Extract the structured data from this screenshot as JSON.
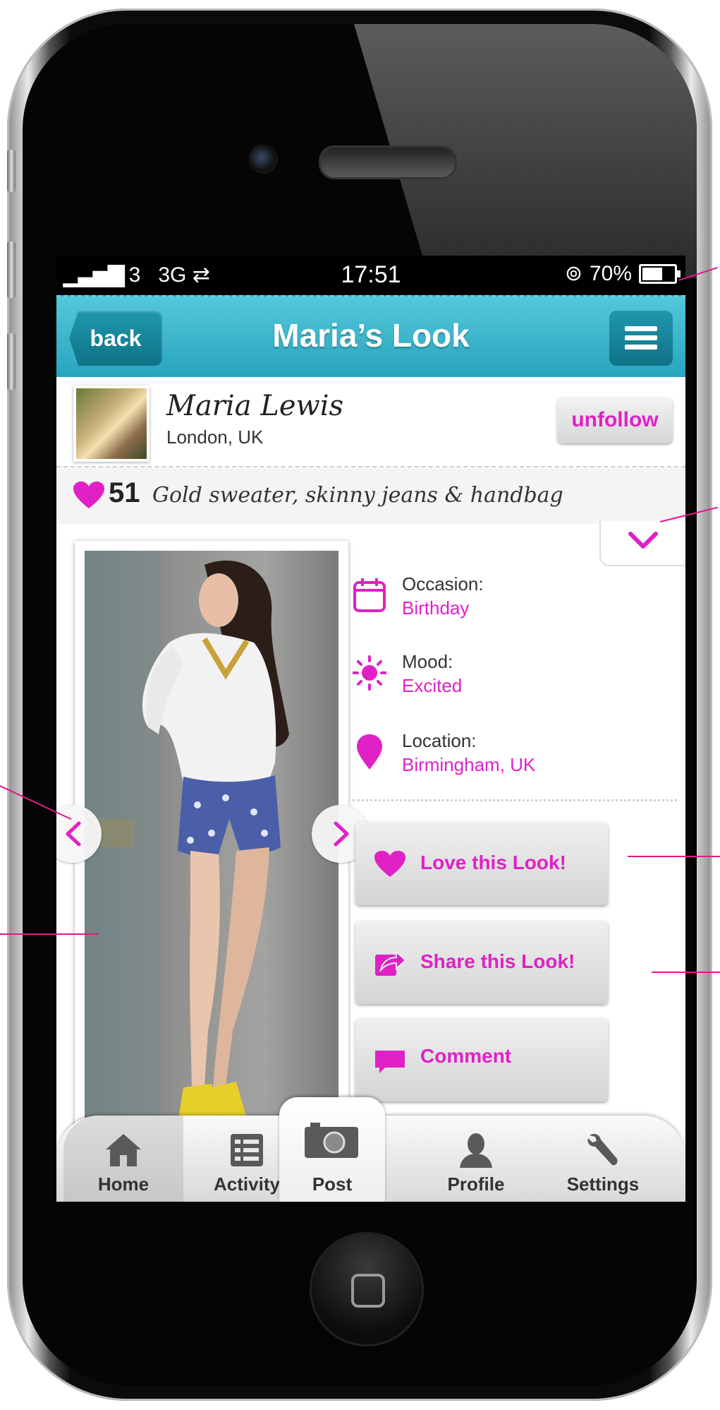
{
  "status_bar": {
    "carrier": "3",
    "network": "3G",
    "time": "17:51",
    "battery": "70%"
  },
  "nav": {
    "back_label": "back",
    "title": "Maria’s Look"
  },
  "user": {
    "name": "Maria Lewis",
    "location": "London, UK",
    "follow_label": "unfollow"
  },
  "look": {
    "likes": "51",
    "title": "Gold sweater, skinny jeans & handbag"
  },
  "details": [
    {
      "label": "Occasion:",
      "value": "Birthday",
      "icon": "calendar-icon"
    },
    {
      "label": "Mood:",
      "value": "Excited",
      "icon": "sun-icon"
    },
    {
      "label": "Location:",
      "value": "Birmingham, UK",
      "icon": "location-pin-icon"
    }
  ],
  "actions": {
    "love": "Love this Look!",
    "share": "Share this Look!",
    "comment": "Comment"
  },
  "tabs": [
    {
      "label": "Home",
      "icon": "house-icon"
    },
    {
      "label": "Activity",
      "icon": "list-icon"
    },
    {
      "label": "Post",
      "icon": "camera-icon"
    },
    {
      "label": "Profile",
      "icon": "person-icon"
    },
    {
      "label": "Settings",
      "icon": "wrench-icon"
    }
  ],
  "colors": {
    "accent": "#e021c6",
    "navbar": "#2eabc3",
    "callout": "#e0198a"
  }
}
